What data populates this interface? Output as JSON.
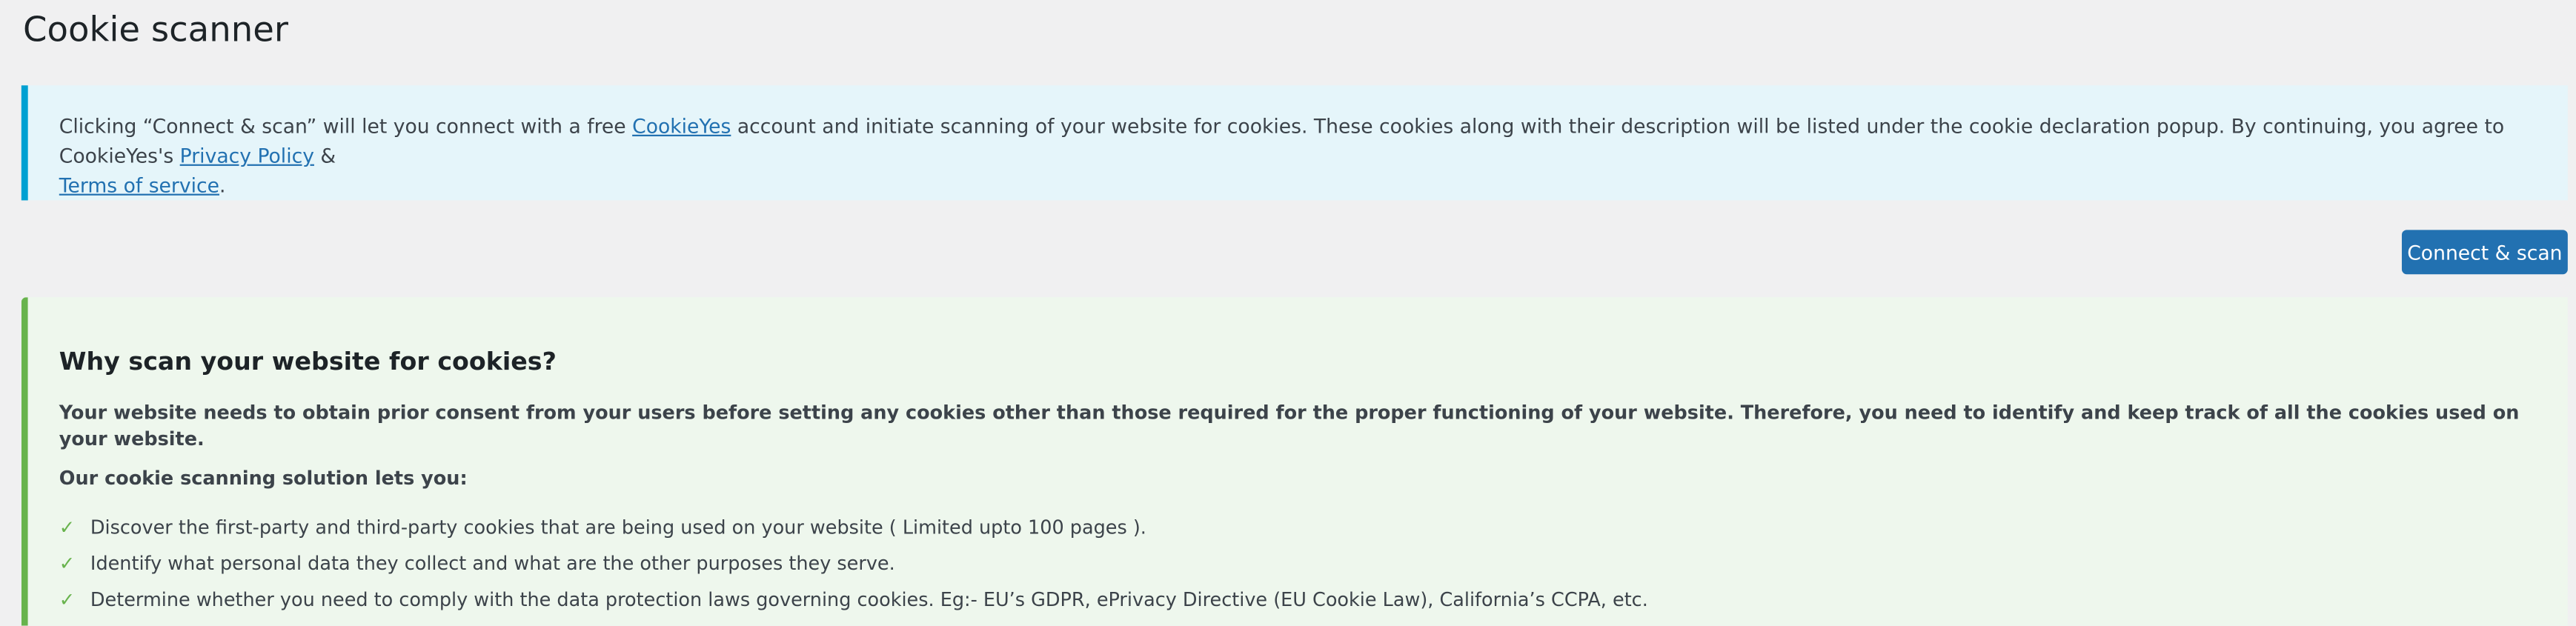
{
  "page_title": "Cookie scanner",
  "notice": {
    "text_1": "Clicking “Connect & scan” will let you connect with a free ",
    "link_cookieyes": "CookieYes",
    "text_2": " account and initiate scanning of your website for cookies. These cookies along with their description will be listed under the cookie declaration popup. By continuing, you agree to CookieYes's ",
    "link_privacy": "Privacy Policy",
    "text_3": " & ",
    "link_terms": "Terms of service",
    "text_4": "."
  },
  "connect_button": "Connect & scan",
  "why": {
    "heading": "Why scan your website for cookies?",
    "intro": "Your website needs to obtain prior consent from your users before setting any cookies other than those required for the proper functioning of your website. Therefore, you need to identify and keep track of all the cookies used on your website.",
    "lead": "Our cookie scanning solution lets you:",
    "check_glyph": "✓",
    "items": [
      "Discover the first-party and third-party cookies that are being used on your website ( Limited upto 100 pages ).",
      "Identify what personal data they collect and what are the other purposes they serve.",
      "Determine whether you need to comply with the data protection laws governing cookies. Eg:- EU’s GDPR, ePrivacy Directive (EU Cookie Law), California’s CCPA, etc."
    ]
  },
  "colors": {
    "accent": "#2271b1",
    "info_border": "#00a0d2",
    "info_bg": "#e5f5fa",
    "success_border": "#68b34d",
    "success_bg": "#eef7ed"
  }
}
